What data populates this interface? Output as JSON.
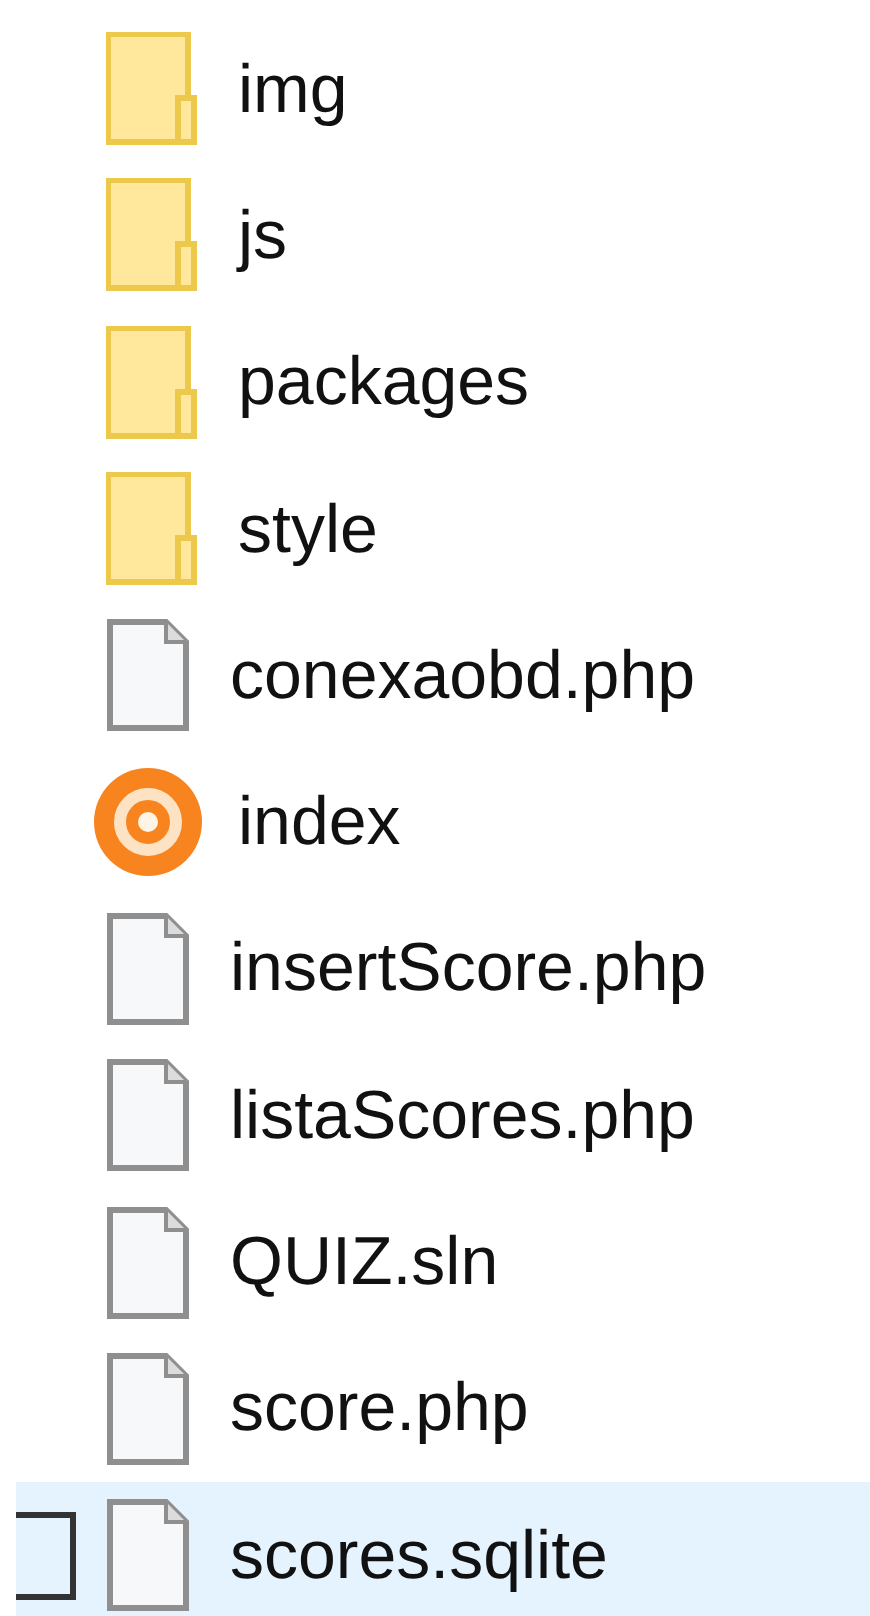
{
  "files": [
    {
      "name": "img",
      "kind": "folder",
      "selected": false
    },
    {
      "name": "js",
      "kind": "folder",
      "selected": false
    },
    {
      "name": "packages",
      "kind": "folder",
      "selected": false
    },
    {
      "name": "style",
      "kind": "folder",
      "selected": false
    },
    {
      "name": "conexaobd.php",
      "kind": "file",
      "selected": false
    },
    {
      "name": "index",
      "kind": "app",
      "selected": false
    },
    {
      "name": "insertScore.php",
      "kind": "file",
      "selected": false
    },
    {
      "name": "listaScores.php",
      "kind": "file",
      "selected": false
    },
    {
      "name": "QUIZ.sln",
      "kind": "file",
      "selected": false
    },
    {
      "name": "score.php",
      "kind": "file",
      "selected": false
    },
    {
      "name": "scores.sqlite",
      "kind": "file",
      "selected": true
    }
  ]
}
